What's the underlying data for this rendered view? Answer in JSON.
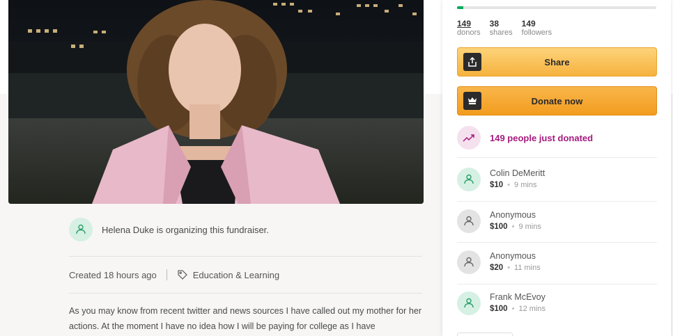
{
  "hero": {
    "icon": "campaign-photo"
  },
  "organizer": {
    "text": "Helena Duke is organizing this fundraiser."
  },
  "meta": {
    "created": "Created 18 hours ago",
    "category": "Education & Learning"
  },
  "story": {
    "text": "As you may know from recent twitter and news sources I have called out my mother for her actions. At the moment I have no idea how I will be paying for college as I have"
  },
  "progress": {
    "fraction": 0.03,
    "color": "#02a95c"
  },
  "stats": {
    "donors": {
      "value": "149",
      "label": "donors"
    },
    "shares": {
      "value": "38",
      "label": "shares"
    },
    "followers": {
      "value": "149",
      "label": "followers"
    }
  },
  "buttons": {
    "share": "Share",
    "donate": "Donate now"
  },
  "recent": {
    "text": "149 people just donated"
  },
  "donations": [
    {
      "name": "Colin DeMeritt",
      "amount": "$10",
      "time": "9 mins",
      "avatar": "green"
    },
    {
      "name": "Anonymous",
      "amount": "$100",
      "time": "9 mins",
      "avatar": "gray"
    },
    {
      "name": "Anonymous",
      "amount": "$20",
      "time": "11 mins",
      "avatar": "gray"
    },
    {
      "name": "Frank McEvoy",
      "amount": "$100",
      "time": "12 mins",
      "avatar": "green"
    }
  ],
  "colors": {
    "accent_green": "#02a95c",
    "button_orange": "#f6b23e",
    "recent_purple": "#a51a7e"
  }
}
